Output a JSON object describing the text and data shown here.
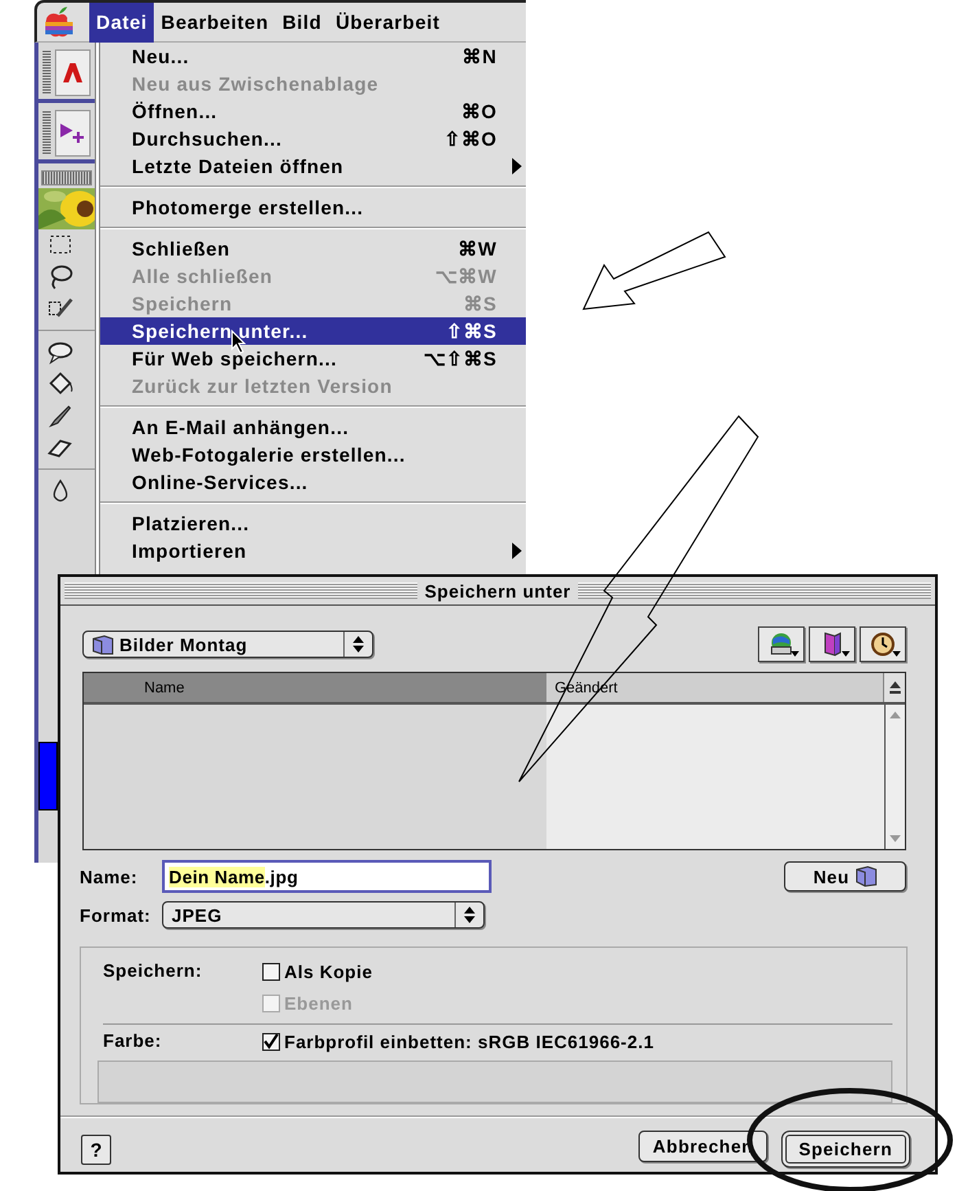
{
  "menu_bar": {
    "items": [
      {
        "label": "Datei",
        "selected": true
      },
      {
        "label": "Bearbeiten",
        "selected": false
      },
      {
        "label": "Bild",
        "selected": false
      },
      {
        "label": "Überarbeit",
        "selected": false
      }
    ]
  },
  "file_menu": {
    "items": [
      {
        "kind": "item",
        "label": "Neu...",
        "shortcut": "⌘N",
        "disabled": false,
        "selected": false
      },
      {
        "kind": "item",
        "label": "Neu aus Zwischenablage",
        "disabled": true,
        "selected": false
      },
      {
        "kind": "item",
        "label": "Öffnen...",
        "shortcut": "⌘O",
        "disabled": false,
        "selected": false
      },
      {
        "kind": "item",
        "label": "Durchsuchen...",
        "shortcut": "⇧⌘O",
        "disabled": false,
        "selected": false
      },
      {
        "kind": "item",
        "label": "Letzte Dateien öffnen",
        "submenu": true,
        "disabled": false,
        "selected": false
      },
      {
        "kind": "separator"
      },
      {
        "kind": "item",
        "label": "Photomerge erstellen...",
        "disabled": false,
        "selected": false
      },
      {
        "kind": "separator"
      },
      {
        "kind": "item",
        "label": "Schließen",
        "shortcut": "⌘W",
        "disabled": false,
        "selected": false
      },
      {
        "kind": "item",
        "label": "Alle schließen",
        "shortcut": "⌥⌘W",
        "disabled": true,
        "selected": false
      },
      {
        "kind": "item",
        "label": "Speichern",
        "shortcut": "⌘S",
        "disabled": true,
        "selected": false
      },
      {
        "kind": "item",
        "label": "Speichern unter...",
        "shortcut": "⇧⌘S",
        "disabled": false,
        "selected": true
      },
      {
        "kind": "item",
        "label": "Für Web speichern...",
        "shortcut": "⌥⇧⌘S",
        "disabled": false,
        "selected": false
      },
      {
        "kind": "item",
        "label": "Zurück zur letzten Version",
        "disabled": true,
        "selected": false
      },
      {
        "kind": "separator"
      },
      {
        "kind": "item",
        "label": "An E-Mail anhängen...",
        "disabled": false,
        "selected": false
      },
      {
        "kind": "item",
        "label": "Web-Fotogalerie erstellen...",
        "disabled": false,
        "selected": false
      },
      {
        "kind": "item",
        "label": "Online-Services...",
        "disabled": false,
        "selected": false
      },
      {
        "kind": "separator"
      },
      {
        "kind": "item",
        "label": "Platzieren...",
        "disabled": false,
        "selected": false
      },
      {
        "kind": "item",
        "label": "Importieren",
        "submenu": true,
        "disabled": false,
        "selected": false
      }
    ]
  },
  "dialog": {
    "title": "Speichern unter",
    "folder": "Bilder Montag",
    "columns": [
      {
        "label": "Name",
        "selected": true
      },
      {
        "label": "Geändert",
        "selected": false
      }
    ],
    "name_label": "Name:",
    "name_field": {
      "selected_text": "Dein Name",
      "rest_text": ".jpg"
    },
    "new_folder_button": "Neu",
    "format_label": "Format:",
    "format_value": "JPEG",
    "options": [
      {
        "label": "Speichern:",
        "checkboxes": [
          {
            "label": "Als Kopie",
            "checked": false,
            "disabled": false
          },
          {
            "label": "Ebenen",
            "checked": false,
            "disabled": true
          }
        ]
      },
      {
        "label": "Farbe:",
        "checkboxes": [
          {
            "label": "Farbprofil einbetten: sRGB IEC61966-2.1",
            "checked": true,
            "disabled": false
          }
        ]
      }
    ],
    "help_button": "?",
    "buttons": [
      {
        "label": "Abbrechen",
        "default": false
      },
      {
        "label": "Speichern",
        "default": true
      }
    ]
  }
}
